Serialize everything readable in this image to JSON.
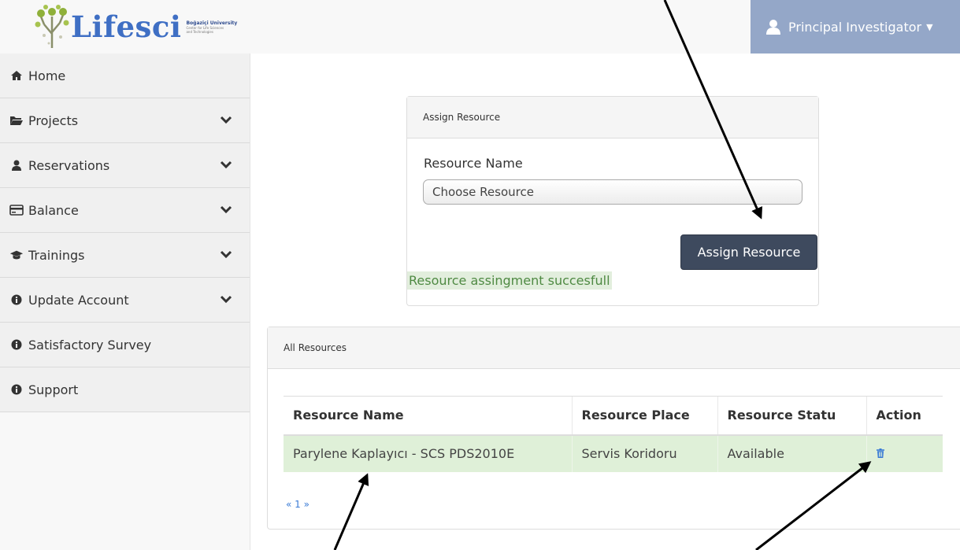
{
  "header": {
    "logo_text": "Lifesci",
    "logo_university": "Boğaziçi University",
    "logo_center_line1": "Center for Life Sciences",
    "logo_center_line2": "and Technologies",
    "user_menu_label": "Principal Investigator"
  },
  "sidebar": {
    "items": [
      {
        "label": "Home",
        "icon": "home-icon",
        "has_submenu": false
      },
      {
        "label": "Projects",
        "icon": "folder-open-icon",
        "has_submenu": true
      },
      {
        "label": "Reservations",
        "icon": "user-icon",
        "has_submenu": true
      },
      {
        "label": "Balance",
        "icon": "credit-card-icon",
        "has_submenu": true
      },
      {
        "label": "Trainings",
        "icon": "graduation-cap-icon",
        "has_submenu": true
      },
      {
        "label": "Update Account",
        "icon": "info-circle-icon",
        "has_submenu": true
      },
      {
        "label": "Satisfactory Survey",
        "icon": "info-circle-icon",
        "has_submenu": false
      },
      {
        "label": "Support",
        "icon": "info-circle-icon",
        "has_submenu": false
      }
    ]
  },
  "assign_panel": {
    "title": "Assign Resource",
    "field_label": "Resource Name",
    "select_value": "Choose Resource",
    "button_label": "Assign Resource",
    "success_message": "Resource assingment succesfull"
  },
  "resources_panel": {
    "title": "All Resources",
    "columns": [
      "Resource Name",
      "Resource Place",
      "Resource Statu",
      "Action"
    ],
    "rows": [
      {
        "name": "Parylene Kaplayıcı - SCS PDS2010E",
        "place": "Servis Koridoru",
        "status": "Available",
        "action_icon": "trash-icon"
      }
    ],
    "pager": {
      "prev": "«",
      "page": "1",
      "next": "»"
    }
  },
  "colors": {
    "user_menu_bg": "#94a7c8",
    "assign_button_bg": "#3e4a5e",
    "success_bg": "#e2eedd",
    "success_text": "#4f8a43",
    "row_bg": "#dff0d8",
    "link_blue": "#3a7bd5"
  }
}
